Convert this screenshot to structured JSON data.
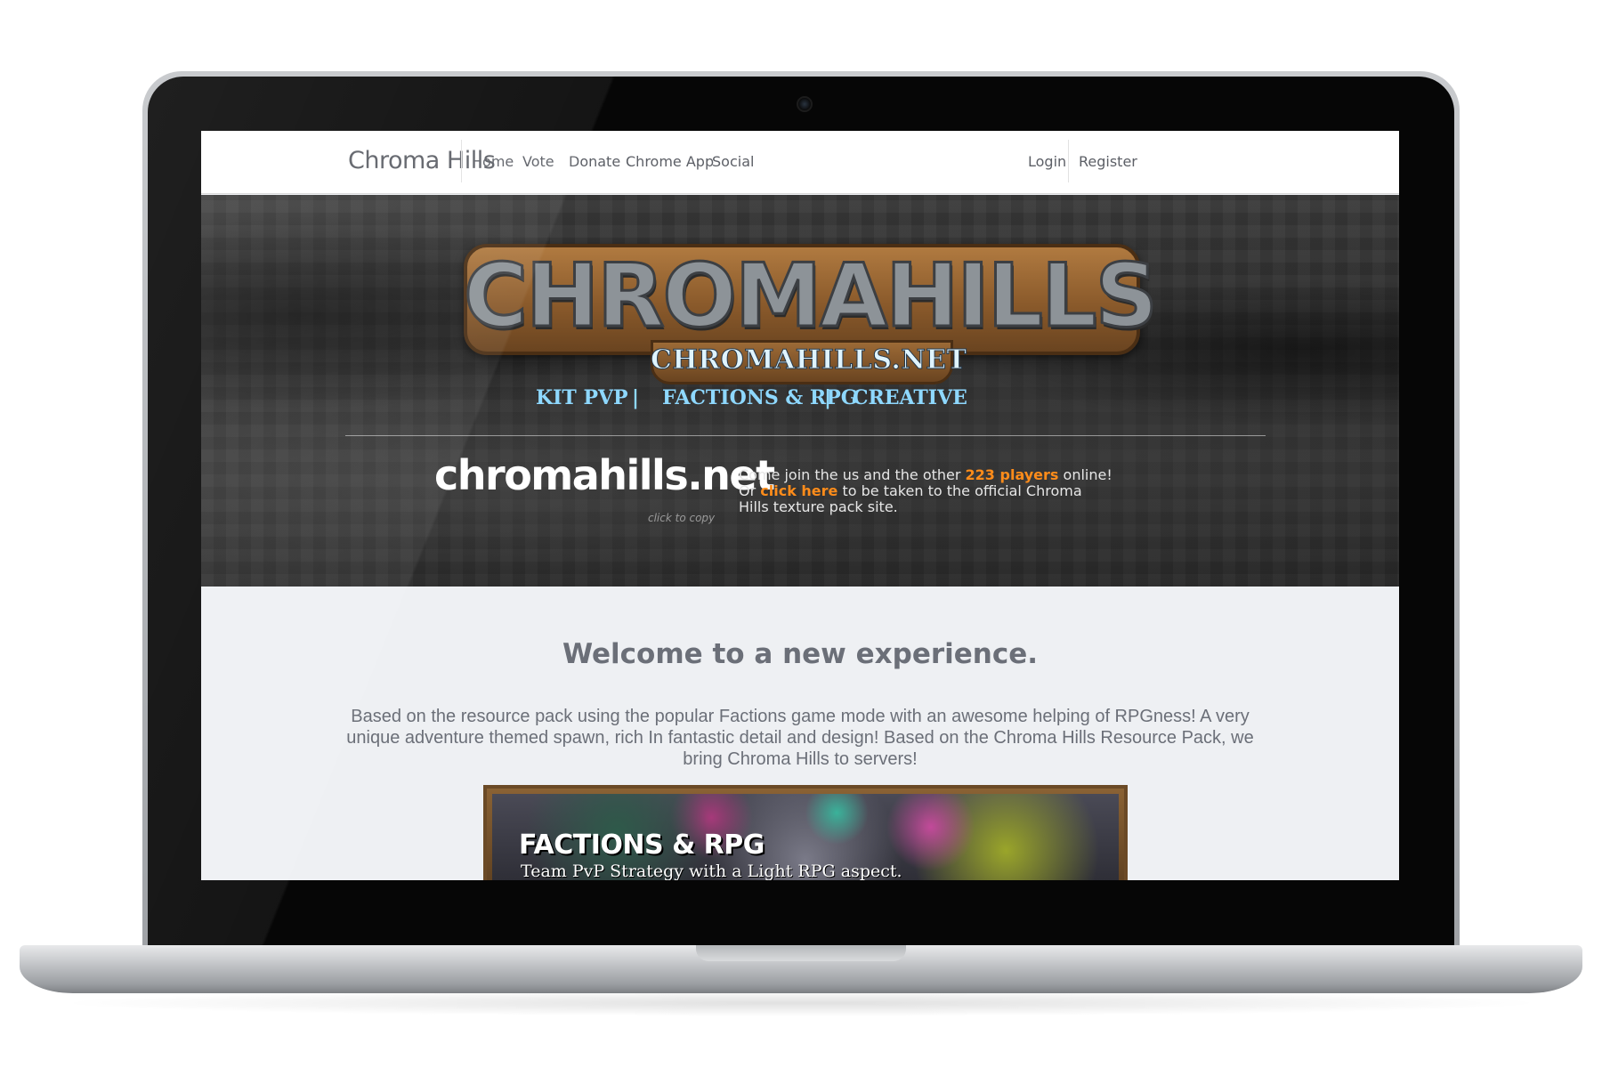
{
  "nav": {
    "brand": "Chroma Hills",
    "links": [
      "Home",
      "Vote",
      "Donate",
      "Chrome App",
      "Social"
    ],
    "login": "Login",
    "register": "Register"
  },
  "hero": {
    "logo_title": "CHROMAHILLS",
    "logo_subtitle": "CHROMAHILLS.NET",
    "modes": [
      "KIT PVP",
      "FACTIONS & RPG",
      "CREATIVE"
    ],
    "mode_separator": "|",
    "server_ip": "chromahills.net",
    "copy_hint": "click to copy",
    "info_line1_prefix": "Come join the us and the other ",
    "info_players": "223 players",
    "info_line1_suffix": " online!",
    "info_line2_prefix": "Or ",
    "info_link": "click here",
    "info_line2_suffix": " to be taken to the official Chroma Hills texture pack site."
  },
  "content": {
    "welcome": "Welcome to a new experience.",
    "intro": "Based on the resource pack using the popular Factions game mode with an awesome helping of RPGness! A very unique adventure themed spawn, rich In fantastic detail and design! Based on the Chroma Hills Resource Pack, we bring Chroma Hills to servers!",
    "banner_title": "FACTIONS & RPG",
    "banner_subtitle": "Team PvP Strategy with a Light RPG aspect."
  },
  "colors": {
    "accent_orange": "#ff8c1a",
    "mode_blue": "#8ed8ff",
    "nav_text": "#5c5f66"
  }
}
